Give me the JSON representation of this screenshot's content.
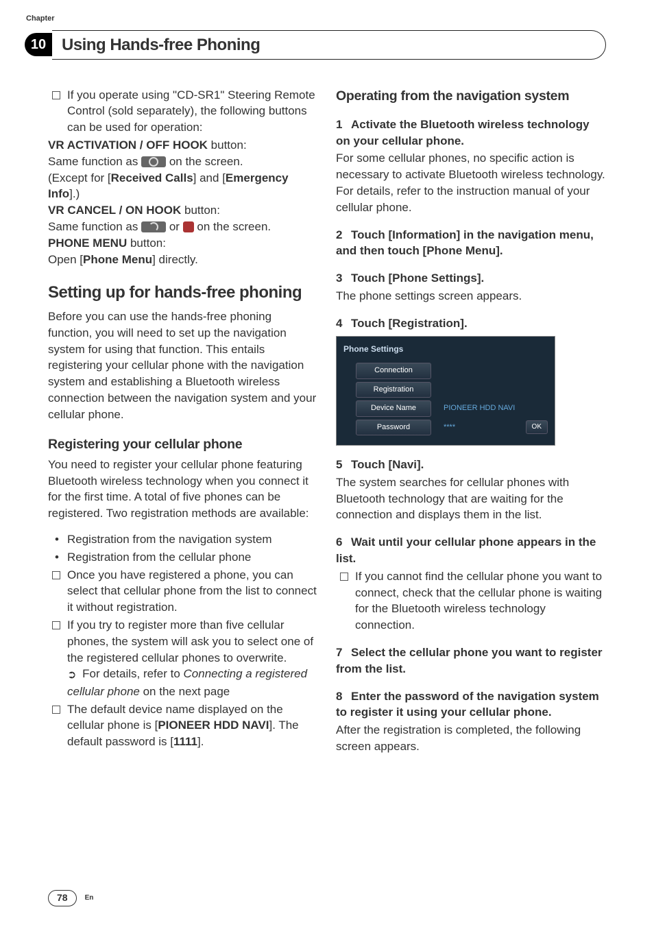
{
  "chapter": {
    "label": "Chapter",
    "number": "10",
    "title": "Using Hands-free Phoning"
  },
  "left": {
    "intro_cd": "If you operate using \"CD-SR1\" Steering Remote Control (sold separately), the following buttons can be used for operation:",
    "b1_label": "VR ACTIVATION / OFF HOOK",
    "b_button": " button:",
    "same_as": "Same function as ",
    "on_screen": " on the screen.",
    "except_open": "(Except for [",
    "received": "Received Calls",
    "and_br": "] and [",
    "emergency": "Emergency Info",
    "except_close": "].)",
    "b2_label": "VR CANCEL / ON HOOK",
    "or_txt": " or ",
    "b3_label": "PHONE MENU",
    "open": "Open [",
    "phone_menu": "Phone Menu",
    "direct": "] directly.",
    "h1_setup": "Setting up for hands-free phoning",
    "setup_para": "Before you can use the hands-free phoning function, you will need to set up the navigation system for using that function. This entails registering your cellular phone with the navigation system and establishing a Bluetooth wireless connection between the navigation system and your cellular phone.",
    "h2_reg": "Registering your cellular phone",
    "reg_para": "You need to register your cellular phone featuring Bluetooth wireless technology when you connect it for the first time. A total of five phones can be registered. Two registration methods are available:",
    "reg_nav": "Registration from the navigation system",
    "reg_cell": "Registration from the cellular phone",
    "once_reg": "Once you have registered a phone, you can select that cellular phone from the list to connect it without registration.",
    "five_phones": "If you try to register more than five cellular phones, the system will ask you to select one of the registered cellular phones to overwrite.",
    "for_details": " For details, refer to ",
    "connecting_ref": "Connecting a registered cellular phone",
    "on_next": " on the next page",
    "default_dev_a": "The default device name displayed on the cellular phone is [",
    "pioneer": "PIONEER HDD NAVI",
    "default_dev_b": "]. The default password is [",
    "pwd": "1111",
    "close_br": "]."
  },
  "right": {
    "h2_op": "Operating from the navigation system",
    "s1": "Activate the Bluetooth wireless technology on your cellular phone.",
    "s1_body": "For some cellular phones, no specific action is necessary to activate Bluetooth wireless technology. For details, refer to the instruction manual of your cellular phone.",
    "s2": "Touch [Information] in the navigation menu, and then touch [Phone Menu].",
    "s3": "Touch [Phone Settings].",
    "s3_body": "The phone settings screen appears.",
    "s4": "Touch [Registration].",
    "shot_title": "Phone Settings",
    "shot_conn": "Connection",
    "shot_reg": "Registration",
    "shot_dev": "Device Name",
    "shot_dev_v": "PIONEER HDD NAVI",
    "shot_pwd": "Password",
    "shot_pwd_v": "****",
    "shot_ok": "OK",
    "s5": "Touch [Navi].",
    "s5_body": "The system searches for cellular phones with Bluetooth technology that are waiting for the connection and displays them in the list.",
    "s6": "Wait until your cellular phone appears in the list.",
    "s6_note": "If you cannot find the cellular phone you want to connect, check that the cellular phone is waiting for the Bluetooth wireless technology connection.",
    "s7": "Select the cellular phone you want to register from the list.",
    "s8": "Enter the password of the navigation system to register it using your cellular phone.",
    "s8_body": "After the registration is completed, the following screen appears."
  },
  "footer": {
    "page": "78",
    "lang": "En"
  }
}
